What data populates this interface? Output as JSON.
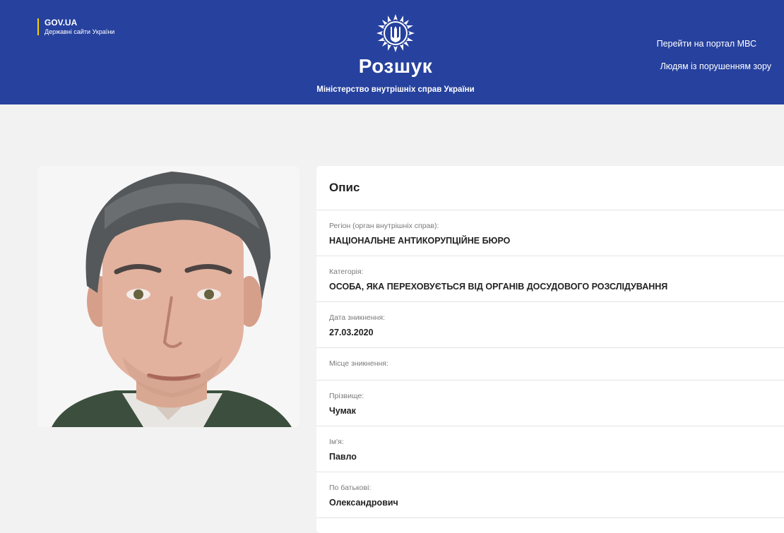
{
  "header": {
    "gov_title": "GOV.UA",
    "gov_subtitle": "Державні сайти України",
    "emblem_icon": "police-star-trident-icon",
    "title": "Розшук",
    "subtitle": "Міністерство внутрішніх справ України",
    "links": {
      "portal": "Перейти на портал МВС",
      "vision": "Людям із порушенням зору"
    }
  },
  "photo": {
    "icon": "person-photo"
  },
  "description": {
    "title": "Опис",
    "fields": [
      {
        "label": "Регіон (орган внутрішніх справ):",
        "value": "НАЦІОНАЛЬНЕ АНТИКОРУПЦІЙНЕ БЮРО"
      },
      {
        "label": "Категорія:",
        "value": "ОСОБА, ЯКА ПЕРЕХОВУЄТЬСЯ ВІД ОРГАНІВ ДОСУДОВОГО РОЗСЛІДУВАННЯ"
      },
      {
        "label": "Дата зникнення:",
        "value": "27.03.2020"
      },
      {
        "label": "Місце зникнення:",
        "value": ""
      },
      {
        "label": "Прізвище:",
        "value": "Чумак"
      },
      {
        "label": "Ім'я:",
        "value": "Павло"
      },
      {
        "label": "По батькові:",
        "value": "Олександрович"
      }
    ]
  },
  "colors": {
    "header_bg": "#26419e",
    "page_bg": "#f2f2f2",
    "accent": "#f5d000"
  }
}
